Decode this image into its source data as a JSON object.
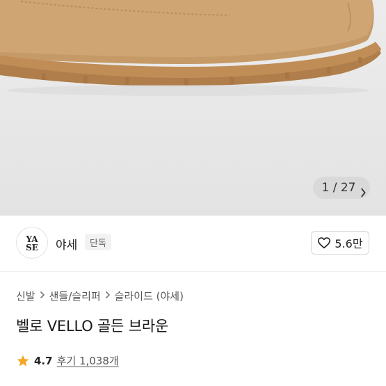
{
  "hero": {
    "image_description_icon": "product-photo-shoe",
    "pager": {
      "current": "1 / 27",
      "next_icon": "chevron-right-icon"
    }
  },
  "seller": {
    "logo_text": "YASE",
    "name": "야세",
    "badge": "단독",
    "like_icon": "heart-outline-icon",
    "like_count": "5.6만"
  },
  "breadcrumb": {
    "items": [
      "신발",
      "샌들/슬리퍼",
      "슬라이드 (야세)"
    ],
    "separator_icon": "chevron-right-icon"
  },
  "product": {
    "title": "벨로 VELLO 골든 브라운",
    "rating": "4.7",
    "reviews": "후기 1,038개",
    "star_color": "#f5a623"
  }
}
